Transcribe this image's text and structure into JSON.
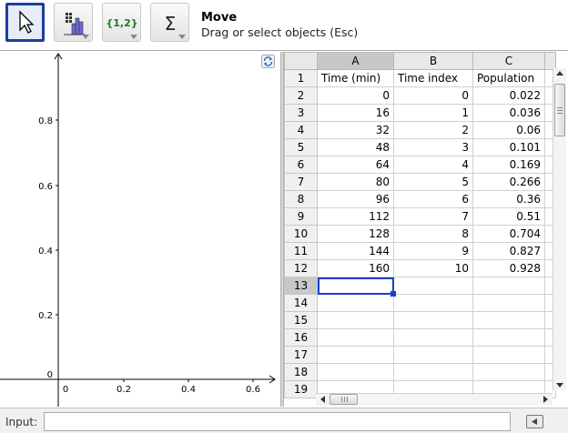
{
  "toolbar": {
    "tools": [
      {
        "name": "move-tool",
        "icon": "cursor-arrow-icon",
        "active": true
      },
      {
        "name": "chart-tool",
        "icon": "bar-chart-icon",
        "active": false
      },
      {
        "name": "list-tool",
        "icon": "list-braces-icon",
        "label": "{1,2}",
        "active": false
      },
      {
        "name": "sum-tool",
        "icon": "sigma-icon",
        "label": "Σ",
        "active": false
      }
    ],
    "active_title": "Move",
    "active_help": "Drag or select objects (Esc)"
  },
  "graphics": {
    "x_ticks": [
      "0",
      "0.2",
      "0.4",
      "0.6"
    ],
    "y_ticks": [
      "0",
      "0.2",
      "0.4",
      "0.6",
      "0.8"
    ],
    "refresh_icon": "refresh-view-icon"
  },
  "spreadsheet": {
    "columns": [
      "A",
      "B",
      "C"
    ],
    "selected_column": "A",
    "row_numbers": [
      "1",
      "2",
      "3",
      "4",
      "5",
      "6",
      "7",
      "8",
      "9",
      "10",
      "11",
      "12",
      "13",
      "14",
      "15",
      "16",
      "17",
      "18",
      "19"
    ],
    "selected_row": "13",
    "rows": [
      [
        "Time (min)",
        "Time index",
        "Population"
      ],
      [
        "0",
        "0",
        "0.022"
      ],
      [
        "16",
        "1",
        "0.036"
      ],
      [
        "32",
        "2",
        "0.06"
      ],
      [
        "48",
        "3",
        "0.101"
      ],
      [
        "64",
        "4",
        "0.169"
      ],
      [
        "80",
        "5",
        "0.266"
      ],
      [
        "96",
        "6",
        "0.36"
      ],
      [
        "112",
        "7",
        "0.51"
      ],
      [
        "128",
        "8",
        "0.704"
      ],
      [
        "144",
        "9",
        "0.827"
      ],
      [
        "160",
        "10",
        "0.928"
      ],
      [
        "",
        "",
        ""
      ],
      [
        "",
        "",
        ""
      ],
      [
        "",
        "",
        ""
      ],
      [
        "",
        "",
        ""
      ],
      [
        "",
        "",
        ""
      ],
      [
        "",
        "",
        ""
      ],
      [
        "",
        "",
        ""
      ]
    ]
  },
  "inputbar": {
    "label": "Input:",
    "value": "",
    "keyboard_icon": "virtual-keyboard-icon"
  },
  "colors": {
    "selection": "#1a3fc8",
    "active_tool_border": "#1a3f9a",
    "header_bg": "#e8e8e8"
  }
}
